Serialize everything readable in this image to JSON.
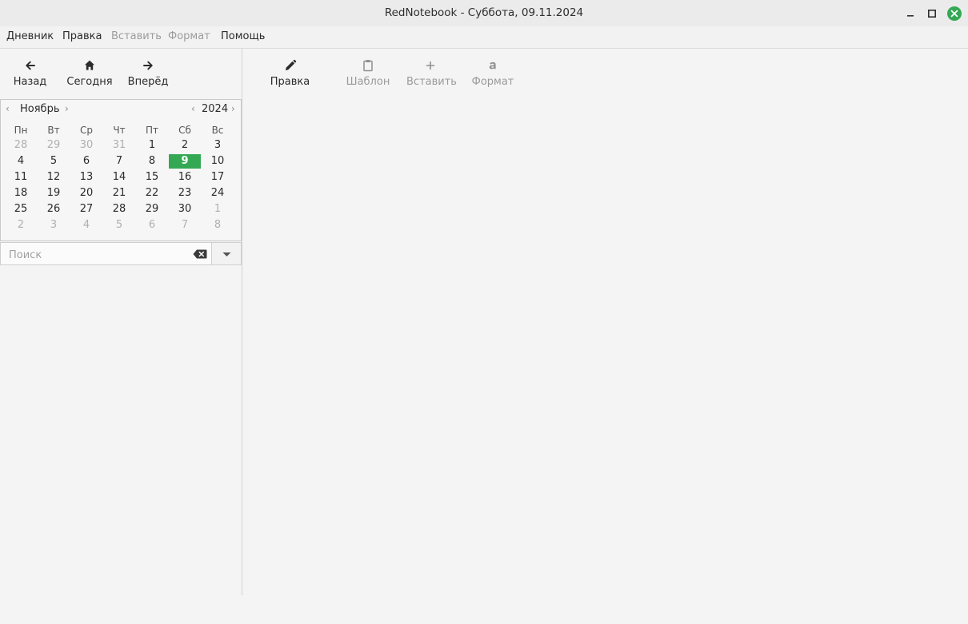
{
  "window": {
    "title": "RedNotebook - Суббота, 09.11.2024",
    "controls": [
      "minimize-icon",
      "maximize-icon",
      "close-icon"
    ],
    "close_color": "#35a854"
  },
  "menubar": {
    "items": [
      {
        "label": "Дневник",
        "enabled": true
      },
      {
        "label": "Правка",
        "enabled": true
      },
      {
        "label": "Вставить",
        "enabled": false
      },
      {
        "label": "Формат",
        "enabled": false
      },
      {
        "label": "Помощь",
        "enabled": true
      }
    ]
  },
  "nav_toolbar": {
    "buttons": [
      {
        "label": "Назад",
        "icon": "arrow-left-icon",
        "enabled": true
      },
      {
        "label": "Сегодня",
        "icon": "home-icon",
        "enabled": true
      },
      {
        "label": "Вперёд",
        "icon": "arrow-right-icon",
        "enabled": true
      }
    ]
  },
  "editor_toolbar": {
    "buttons": [
      {
        "label": "Правка",
        "icon": "pencil-icon",
        "enabled": true
      },
      {
        "label": "Шаблон",
        "icon": "clipboard-icon",
        "enabled": false
      },
      {
        "label": "Вставить",
        "icon": "plus-icon",
        "enabled": false
      },
      {
        "label": "Формат",
        "icon": "format-text-icon",
        "enabled": false
      }
    ]
  },
  "calendar": {
    "month": "Ноябрь",
    "year": "2024",
    "weekdays": [
      "Пн",
      "Вт",
      "Ср",
      "Чт",
      "Пт",
      "Сб",
      "Вс"
    ],
    "weeks": [
      [
        "28",
        "29",
        "30",
        "31",
        "1",
        "2",
        "3"
      ],
      [
        "4",
        "5",
        "6",
        "7",
        "8",
        "9",
        "10"
      ],
      [
        "11",
        "12",
        "13",
        "14",
        "15",
        "16",
        "17"
      ],
      [
        "18",
        "19",
        "20",
        "21",
        "22",
        "23",
        "24"
      ],
      [
        "25",
        "26",
        "27",
        "28",
        "29",
        "30",
        "1"
      ],
      [
        "2",
        "3",
        "4",
        "5",
        "6",
        "7",
        "8"
      ]
    ],
    "other_month": [
      [
        true,
        true,
        true,
        true,
        false,
        false,
        false
      ],
      [
        false,
        false,
        false,
        false,
        false,
        false,
        false
      ],
      [
        false,
        false,
        false,
        false,
        false,
        false,
        false
      ],
      [
        false,
        false,
        false,
        false,
        false,
        false,
        false
      ],
      [
        false,
        false,
        false,
        false,
        false,
        false,
        true
      ],
      [
        true,
        true,
        true,
        true,
        true,
        true,
        true
      ]
    ],
    "selected_day": "9",
    "selected_color": "#35a854"
  },
  "search": {
    "placeholder": "Поиск",
    "value": ""
  }
}
